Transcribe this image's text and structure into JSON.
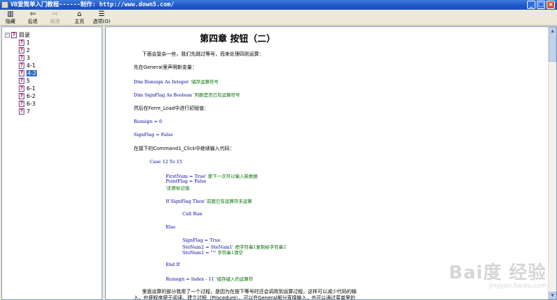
{
  "window": {
    "title": "VB爱简单入门教程------制作:  http://www.down5.com/"
  },
  "window_buttons": {
    "minimize": "_",
    "maximize": "□",
    "close": "×"
  },
  "toolbar": [
    {
      "label": "隐藏",
      "icon": "hide-icon",
      "enabled": true
    },
    {
      "label": "后退",
      "icon": "back-arrow-icon",
      "enabled": true
    },
    {
      "label": "前进",
      "icon": "forward-arrow-icon",
      "enabled": false
    },
    {
      "label": "主页",
      "icon": "home-icon",
      "enabled": true
    },
    {
      "label": "选项(O)",
      "icon": "options-icon",
      "enabled": true
    }
  ],
  "tree": {
    "root": "目录",
    "items": [
      "1",
      "2",
      "3",
      "4-1",
      "4-2",
      "5",
      "6-1",
      "6-2",
      "6-3",
      "7"
    ],
    "selected": "4-2"
  },
  "content": {
    "heading": "第四章   按钮（二）",
    "p1": "下面会复杂一些，我们先跳过等号，而来处理四则运算：",
    "p2": "先在General里声明新变量：",
    "c1a": "Dim Runsign As Integer ",
    "c1b": "'储存运算符号",
    "c2a": "Dim SignFlag As Boolean ",
    "c2b": "'判断是否已有运算符号",
    "p3": "然后在Form_Load中进行初赋值：",
    "c3": "Runsign = 0",
    "c4": "SignFlag = False",
    "p4": "在接下的Command1_Click中继续输入代码：",
    "c5": "Case 12 To 15",
    "c6a": "FirstNum = True' ",
    "c6b": "使下一次可以输入新数据",
    "c7": "PointFlag = False",
    "c8": "'还原标记值",
    "c9a": "If SignFlag Then' ",
    "c9b": "前面已有运算符未运算",
    "c10": "Call Run",
    "c11": "Else",
    "c12": "SignFlag = True",
    "c13a": "SteNum2 = SteNum1' ",
    "c13b": "把字符串1复制给字符串2",
    "c14a": "SteNum1 = \"\"' ",
    "c14b": "字符串1清空",
    "c15": "End If",
    "c16a": "Runsign = Index - 11  ",
    "c16b": "'储存键入的运算符",
    "p5": "里面运算的部分我用了一个过程，是因为在按下等号时还会调用到运算过程，这样可以减少代码的输",
    "p6": "入，也便程序便于阅读。建立过程（Procedure），可以在General部分直接输入，也可以通过菜单里的"
  },
  "watermark": {
    "line1": "Bai度 经验",
    "line2": "jingyan.baidu.com"
  }
}
